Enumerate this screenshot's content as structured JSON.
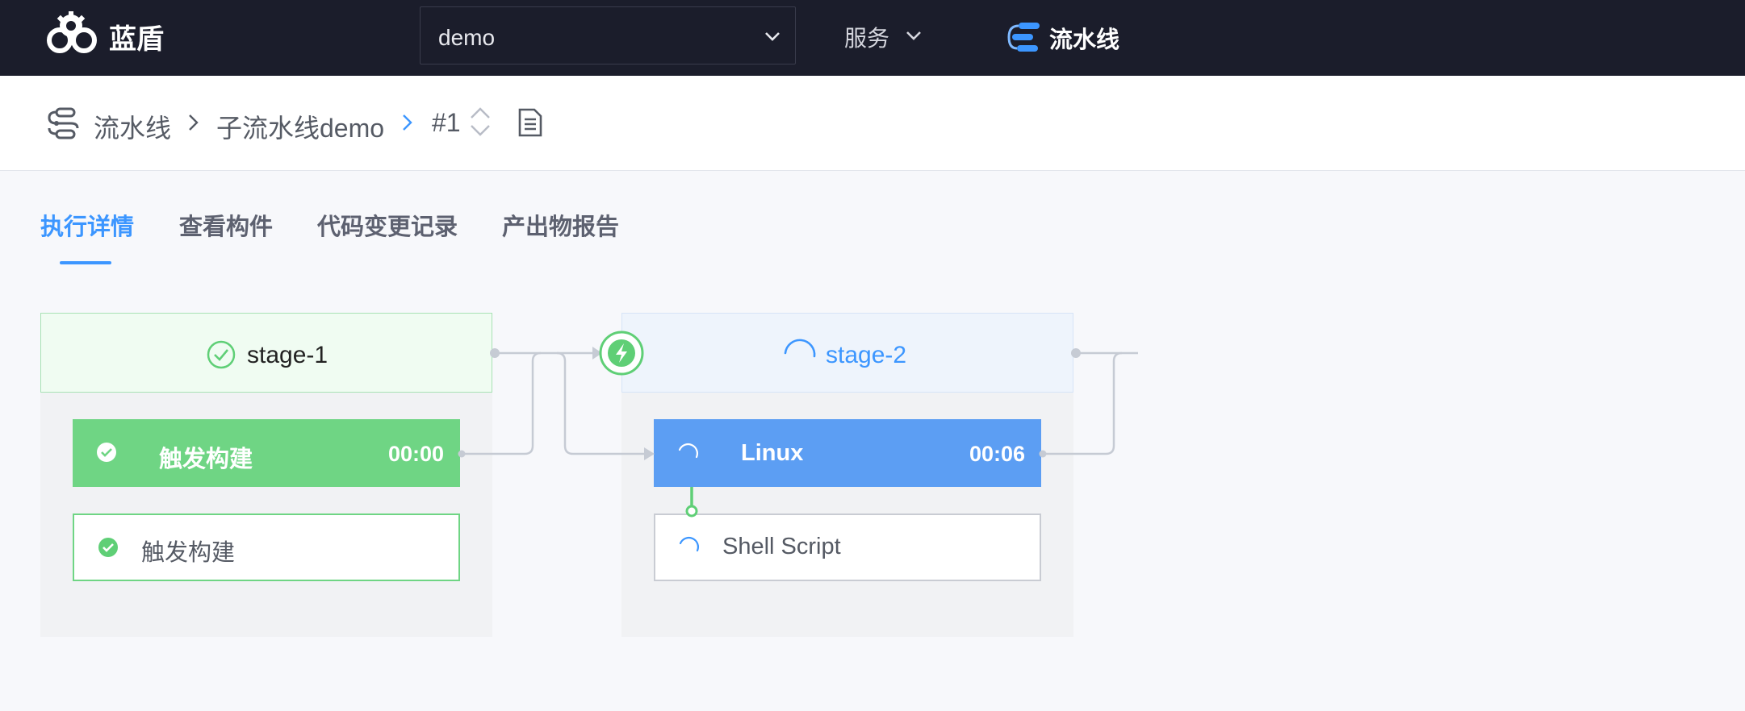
{
  "header": {
    "brand": "蓝盾",
    "project_select": {
      "value": "demo"
    },
    "services_menu": "服务",
    "pipeline_nav": "流水线",
    "colors": {
      "background": "#1b1d2b",
      "accent": "#3c96ff"
    }
  },
  "breadcrumb": {
    "root": "流水线",
    "pipeline": "子流水线demo",
    "build": "#1"
  },
  "tabs": [
    {
      "label": "执行详情",
      "active": true
    },
    {
      "label": "查看构件",
      "active": false
    },
    {
      "label": "代码变更记录",
      "active": false
    },
    {
      "label": "产出物报告",
      "active": false
    }
  ],
  "stages": [
    {
      "name": "stage-1",
      "status": "success",
      "job": {
        "name": "触发构建",
        "time": "00:00",
        "status": "success"
      },
      "steps": [
        {
          "name": "触发构建",
          "status": "success"
        }
      ]
    },
    {
      "name": "stage-2",
      "status": "running",
      "job": {
        "name": "Linux",
        "time": "00:06",
        "status": "running"
      },
      "steps": [
        {
          "name": "Shell Script",
          "status": "running"
        }
      ]
    }
  ],
  "colors": {
    "success": "#6fd584",
    "running": "#5c9ef3",
    "connector": "#c6cbd4"
  }
}
